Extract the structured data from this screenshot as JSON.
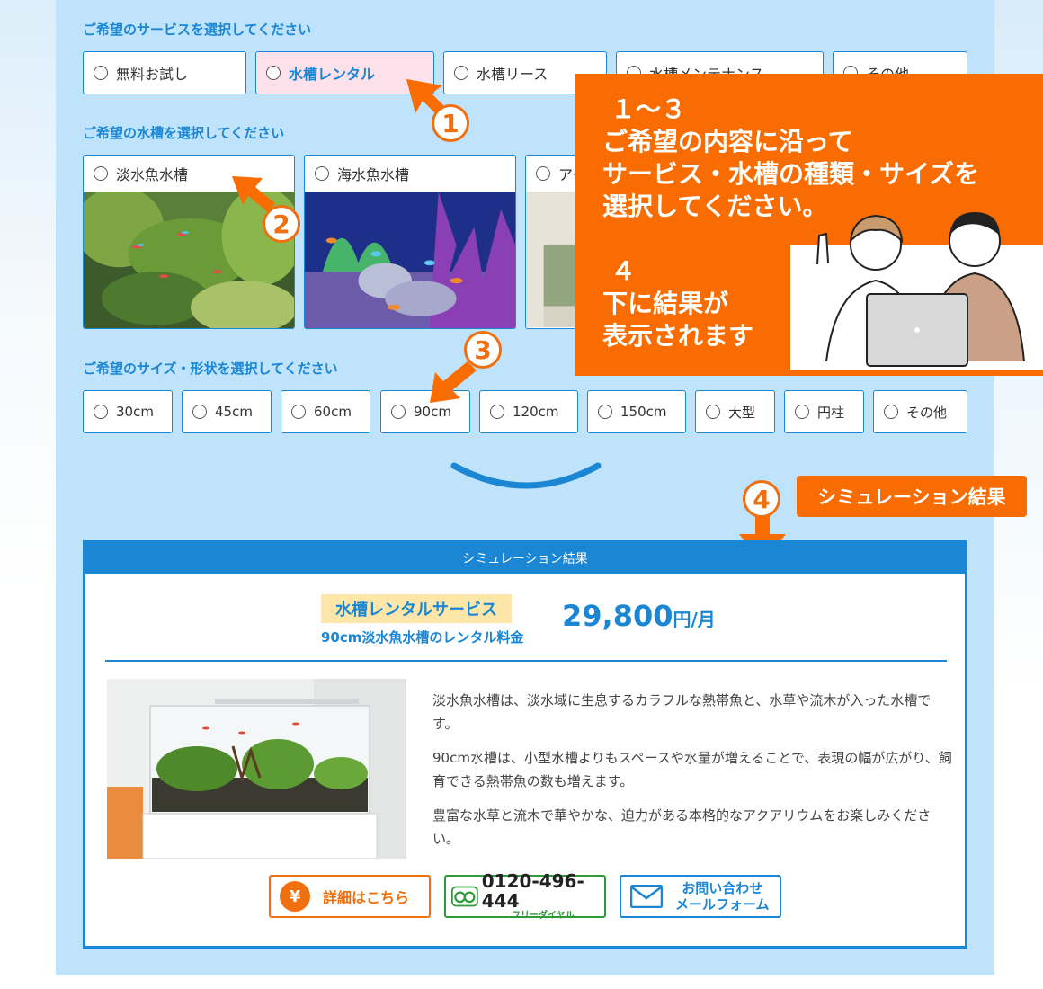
{
  "service_section": {
    "title": "ご希望のサービスを選択してください",
    "options": [
      {
        "label": "無料お試し",
        "selected": false
      },
      {
        "label": "水槽レンタル",
        "selected": true
      },
      {
        "label": "水槽リース",
        "selected": false
      },
      {
        "label": "水槽メンテナンス",
        "selected": false
      },
      {
        "label": "その他",
        "selected": false
      }
    ]
  },
  "tank_section": {
    "title": "ご希望の水槽を選択してください",
    "options": [
      {
        "label": "淡水魚水槽"
      },
      {
        "label": "海水魚水槽"
      },
      {
        "label": "アクアテラリウム"
      }
    ]
  },
  "size_section": {
    "title": "ご希望のサイズ・形状を選択してください",
    "options": [
      {
        "label": "30cm"
      },
      {
        "label": "45cm"
      },
      {
        "label": "60cm"
      },
      {
        "label": "90cm"
      },
      {
        "label": "120cm"
      },
      {
        "label": "150cm"
      },
      {
        "label": "大型"
      },
      {
        "label": "円柱"
      },
      {
        "label": "その他"
      }
    ]
  },
  "step_markers": [
    "1",
    "2",
    "3",
    "4"
  ],
  "callout": {
    "line1": "１～３",
    "line2": "ご希望の内容に沿って",
    "line3": "サービス・水槽の種類・サイズを",
    "line4": "選択してください。",
    "line5": "４",
    "line6": "下に結果が",
    "line7": "表示されます"
  },
  "result_tag": "シミュレーション結果",
  "result": {
    "header": "シミュレーション結果",
    "service_badge": "水槽レンタルサービス",
    "service_sub": "90cm淡水魚水槽のレンタル料金",
    "price": "29,800",
    "price_unit": "円/月",
    "paragraphs": [
      "淡水魚水槽は、淡水域に生息するカラフルな熱帯魚と、水草や流木が入った水槽です。",
      "90cm水槽は、小型水槽よりもスペースや水量が増えることで、表現の幅が広がり、飼育できる熱帯魚の数も増えます。",
      "豊富な水草と流木で華やかな、迫力がある本格的なアクアリウムをお楽しみください。"
    ]
  },
  "buttons": {
    "detail": {
      "icon": "¥",
      "label": "詳細はこちら"
    },
    "phone": {
      "number": "0120-496-444",
      "sub": "フリーダイヤル"
    },
    "mail": {
      "line1": "お問い合わせ",
      "line2": "メールフォーム"
    }
  },
  "colors": {
    "accent": "#1a86d4",
    "orange": "#f86c02",
    "panel": "#bfe3fa"
  }
}
